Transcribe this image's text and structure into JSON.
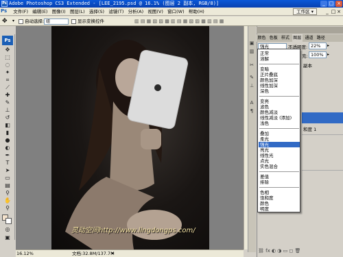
{
  "window": {
    "title": "Adobe Photoshop CS3 Extended - [LEE_2195.psd @ 16.1% (图层 2 副本, RGB/8)]"
  },
  "menu": [
    "文件(F)",
    "编辑(E)",
    "图像(I)",
    "图层(L)",
    "选择(S)",
    "滤镜(T)",
    "分析(A)",
    "视图(V)",
    "窗口(W)",
    "帮助(H)"
  ],
  "workspace_label": "工作区 ▾",
  "options": {
    "auto_select_label": "自动选择:",
    "auto_select_value": "组",
    "show_transform_label": "显示变换控件"
  },
  "panel": {
    "tabs": [
      "颜色",
      "色板",
      "样式",
      "图层",
      "通道",
      "路径"
    ],
    "blend_mode_value": "强光",
    "opacity_label": "不透明度:",
    "opacity_value": "22%",
    "fill_label": "充:",
    "fill_value": "100%",
    "layer_partial_1": "副本",
    "layer_partial_2": "和度 1"
  },
  "blend_modes": {
    "group1": [
      "正常",
      "溶解"
    ],
    "group2": [
      "变暗",
      "正片叠底",
      "颜色加深",
      "线性加深",
      "深色"
    ],
    "group3": [
      "变亮",
      "滤色",
      "颜色减淡",
      "线性减淡 (添加)",
      "浅色"
    ],
    "group4": [
      "叠加",
      "柔光",
      "强光",
      "亮光",
      "线性光",
      "点光",
      "实色混合"
    ],
    "group5": [
      "差值",
      "排除"
    ],
    "group6": [
      "色相",
      "饱和度",
      "颜色",
      "明度"
    ],
    "selected": "强光"
  },
  "canvas": {
    "watermark": "灵动空间http://www.lingdongps.com/"
  },
  "status": {
    "zoom": "16.12%",
    "doc_size": "文档:32.8M/137.7M"
  }
}
